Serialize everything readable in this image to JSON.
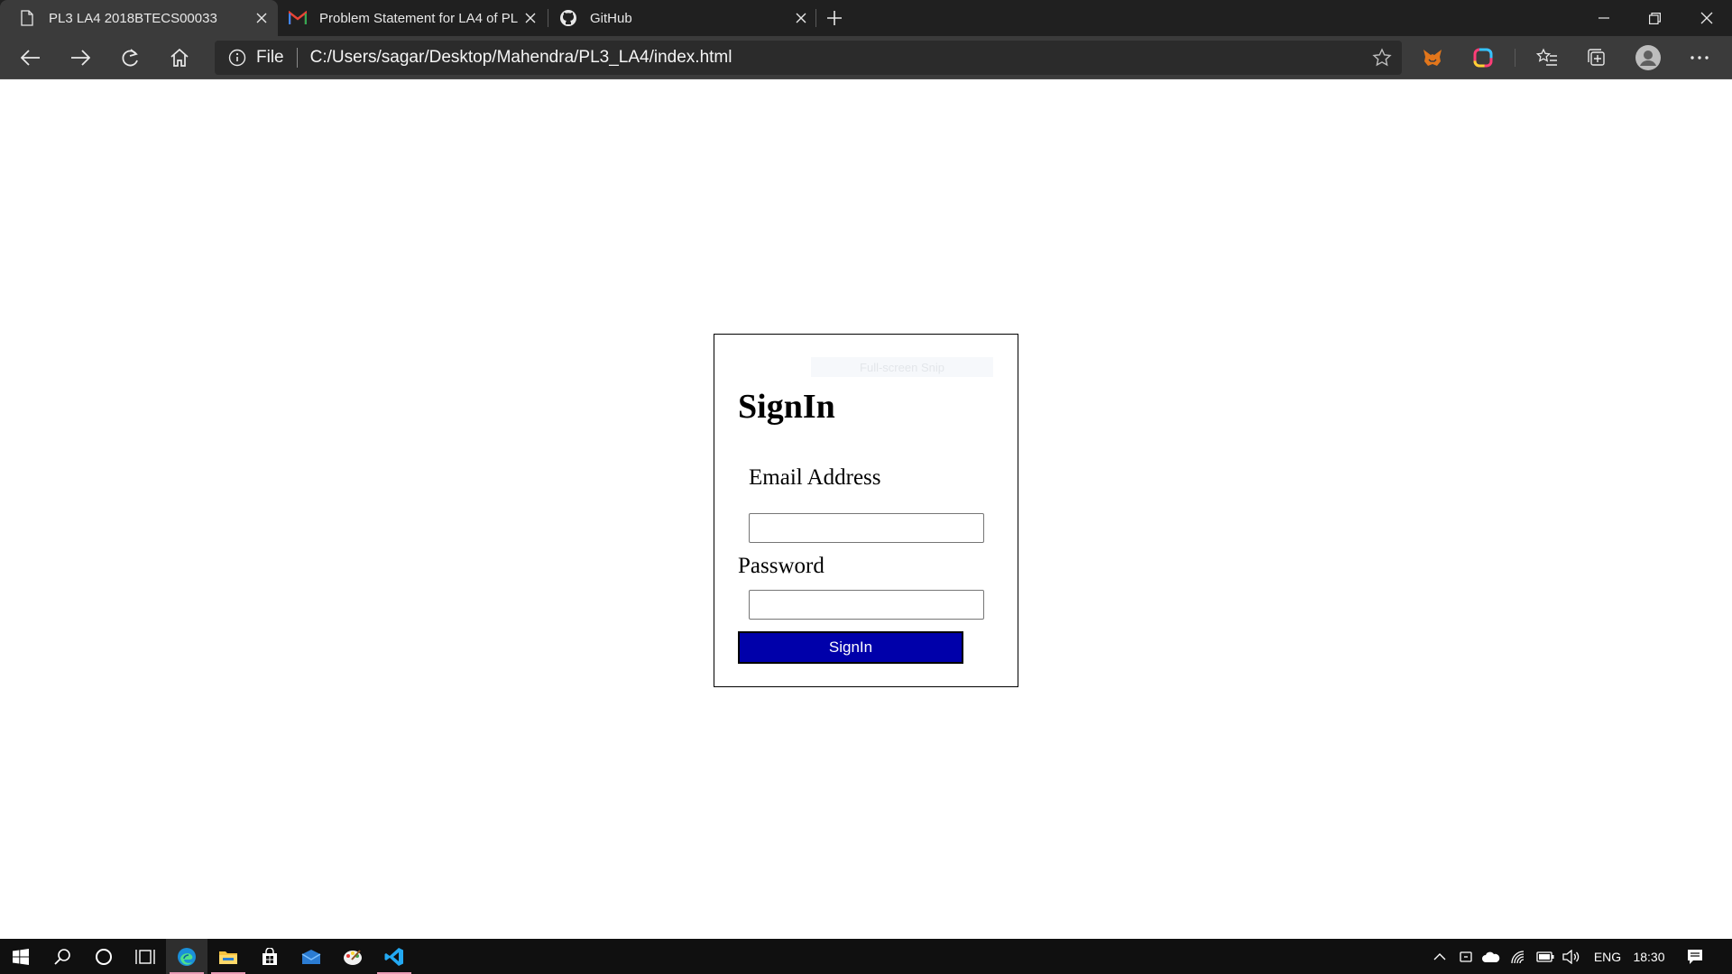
{
  "browser": {
    "tabs": [
      {
        "title": "PL3 LA4 2018BTECS00033",
        "icon": "page-icon",
        "active": true
      },
      {
        "title": "Problem Statement for LA4 of PL",
        "icon": "gmail-icon",
        "active": false
      },
      {
        "title": "GitHub",
        "icon": "github-icon",
        "active": false
      }
    ],
    "address": {
      "scheme_label": "File",
      "url": "C:/Users/sagar/Desktop/Mahendra/PL3_LA4/index.html"
    },
    "colors": {
      "tabstrip": "#202020",
      "toolbar": "#3b3b3b"
    }
  },
  "page": {
    "snip_overlay_text": "Full-screen Snip",
    "heading": "SignIn",
    "email_label": "Email Address",
    "email_value": "",
    "password_label": "Password",
    "password_value": "",
    "button_label": "SignIn",
    "colors": {
      "button_bg": "#0000aa",
      "button_text": "#ffffff"
    }
  },
  "taskbar": {
    "pinned": [
      "windows-start-icon",
      "search-icon",
      "cortana-icon",
      "task-view-icon",
      "edge-icon",
      "file-explorer-icon",
      "store-icon",
      "mail-icon",
      "paint-icon",
      "vscode-icon"
    ],
    "tray": {
      "language": "ENG",
      "time": "18:30"
    }
  }
}
